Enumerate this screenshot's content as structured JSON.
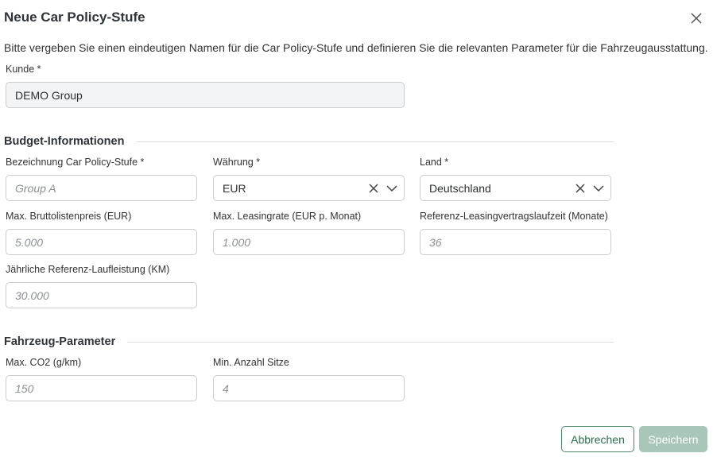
{
  "dialog": {
    "title": "Neue Car Policy-Stufe",
    "close_icon": "close-icon",
    "intro": "Bitte vergeben Sie einen eindeutigen Namen für die Car Policy-Stufe und definieren Sie die relevanten Parameter für die Fahrzeugausstattung."
  },
  "customer": {
    "label": "Kunde *",
    "value": "DEMO Group"
  },
  "budget": {
    "heading": "Budget-Informationen",
    "name_label": "Bezeichnung Car Policy-Stufe *",
    "name_placeholder": "Group A",
    "currency_label": "Währung *",
    "currency_value": "EUR",
    "country_label": "Land *",
    "country_value": "Deutschland",
    "max_price_label": "Max. Bruttolistenpreis (EUR)",
    "max_price_placeholder": "5.000",
    "max_rate_label": "Max. Leasingrate (EUR p. Monat)",
    "max_rate_placeholder": "1.000",
    "term_label": "Referenz-Leasingvertragslaufzeit (Monate)",
    "term_placeholder": "36",
    "mileage_label": "Jährliche Referenz-Laufleistung (KM)",
    "mileage_placeholder": "30.000"
  },
  "vehicle": {
    "heading": "Fahrzeug-Parameter",
    "co2_label": "Max. CO2 (g/km)",
    "co2_placeholder": "150",
    "seats_label": "Min. Anzahl Sitze",
    "seats_placeholder": "4"
  },
  "actions": {
    "cancel_label": "Abbrechen",
    "save_label": "Speichern"
  },
  "colors": {
    "accent": "#2f6c4c",
    "save_disabled": "#a9c7b8",
    "field_border": "#c9cdd1"
  }
}
